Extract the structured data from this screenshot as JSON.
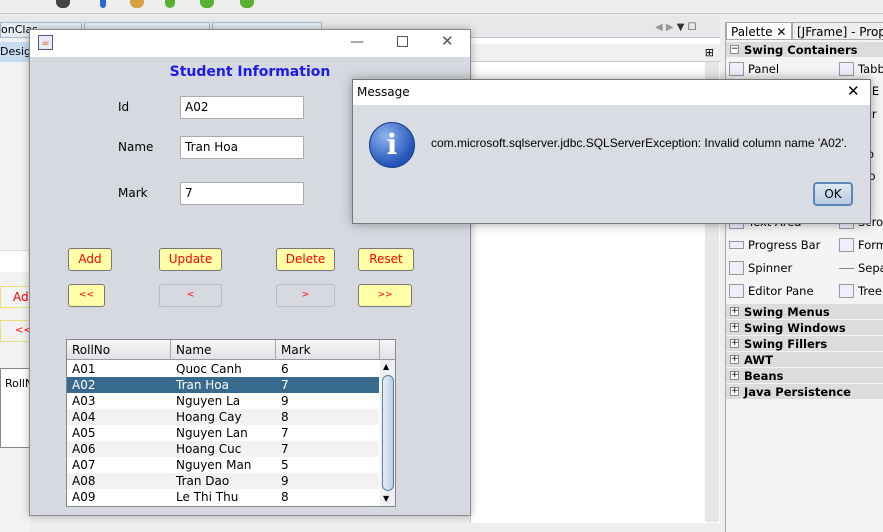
{
  "ide": {
    "left_tab": "onClas",
    "left_design": "Desig",
    "left_add": "Add",
    "left_prev": "<<",
    "left_rollno": "RollN",
    "palette": {
      "tab_palette": "Palette",
      "tab_properties": "[JFrame] - Prope",
      "swing_containers": "Swing Containers",
      "items": [
        "Panel",
        "Tabbe",
        "ol E",
        "yer",
        "tto",
        "dio",
        "t",
        "Text Area",
        "Scroll",
        "Progress Bar",
        "Forma",
        "Spinner",
        "Separ",
        "Editor Pane",
        "Tree"
      ],
      "categories": [
        "Swing Menus",
        "Swing Windows",
        "Swing Fillers",
        "AWT",
        "Beans",
        "Java Persistence"
      ]
    }
  },
  "frame": {
    "title_icon": "java-icon",
    "heading": "Student Information",
    "labels": {
      "id": "Id",
      "name": "Name",
      "mark": "Mark"
    },
    "values": {
      "id": "A02",
      "name": "Tran Hoa",
      "mark": "7"
    },
    "buttons": {
      "add": "Add",
      "update": "Update",
      "delete": "Delete",
      "reset": "Reset",
      "first": "<<",
      "prev": "<",
      "next": ">",
      "last": ">>"
    },
    "table": {
      "columns": [
        "RollNo",
        "Name",
        "Mark"
      ],
      "rows": [
        [
          "A01",
          "Quoc Canh",
          "6"
        ],
        [
          "A02",
          "Tran Hoa",
          "7"
        ],
        [
          "A03",
          "Nguyen La",
          "9"
        ],
        [
          "A04",
          "Hoang Cay",
          "8"
        ],
        [
          "A05",
          "Nguyen Lan",
          "7"
        ],
        [
          "A06",
          "Hoang Cuc",
          "7"
        ],
        [
          "A07",
          "Nguyen Man",
          "5"
        ],
        [
          "A08",
          "Tran Dao",
          "9"
        ],
        [
          "A09",
          "Le Thi Thu",
          "8"
        ]
      ],
      "selected_row": 1
    }
  },
  "dialog": {
    "title": "Message",
    "message": "com.microsoft.sqlserver.jdbc.SQLServerException: Invalid column name 'A02'.",
    "ok": "OK",
    "icon": "info-icon"
  },
  "colors": {
    "heading": "#1a1aee",
    "button_bg": "#ffffa8",
    "button_text": "#ff0000",
    "selection": "#386a8e"
  }
}
